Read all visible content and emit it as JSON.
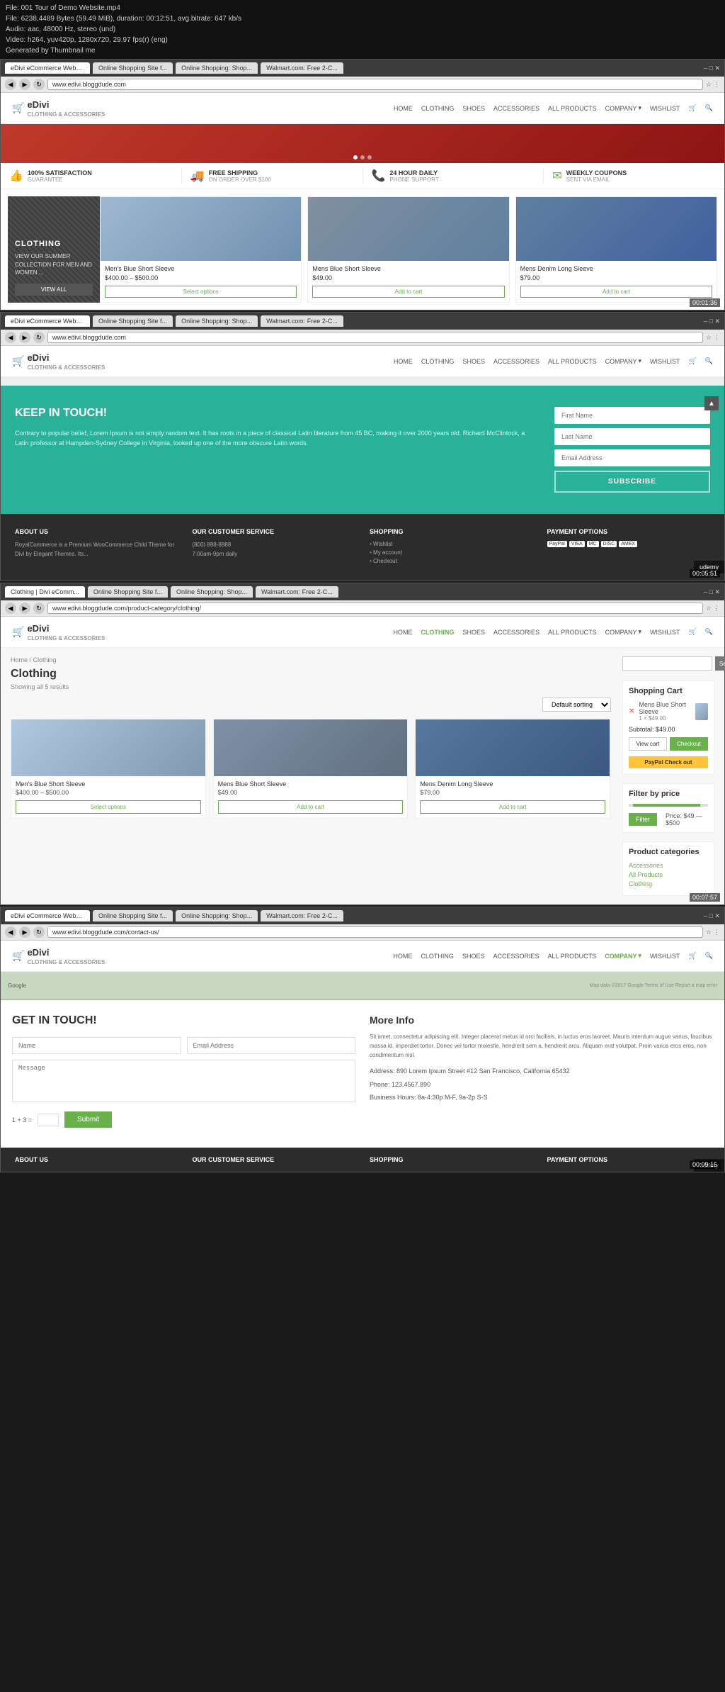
{
  "videoInfo": {
    "filename": "File: 001 Tour of Demo Website.mp4",
    "size": "File: 6238,4489 Bytes (59.49 MiB), duration: 00:12:51, avg.bitrate: 647 kb/s",
    "audio": "Audio: aac, 48000 Hz, stereo (und)",
    "video": "Video: h264, yuv420p, 1280x720, 29.97 fps(r) (eng)",
    "generated": "Generated by Thumbnail me"
  },
  "section1": {
    "tabs": [
      "eDivi eCommerce Webs...",
      "Online Shopping Site f...",
      "Online Shopping: Shop...",
      "Walmart.com: Free 2-C..."
    ],
    "activeTab": 0,
    "url": "www.edivi.bloggdude.com",
    "timestamp": "00:01:36",
    "nav": {
      "logo": "eDivi",
      "logoSub": "CLOTHING & ACCESSORIES",
      "links": [
        "HOME",
        "CLOTHING",
        "SHOES",
        "ACCESSORIES",
        "ALL PRODUCTS",
        "COMPANY",
        "WISHLIST"
      ]
    },
    "features": [
      {
        "icon": "👍",
        "title": "100% SATISFACTION",
        "sub": "GUARANTEE"
      },
      {
        "icon": "🚚",
        "title": "FREE SHIPPING",
        "sub": "ON ORDER OVER $100"
      },
      {
        "icon": "📞",
        "title": "24 HOUR DAILY",
        "sub": "PHONE SUPPORT"
      },
      {
        "icon": "✉",
        "title": "WEEKLY COUPONS",
        "sub": "SENT VIA EMAIL"
      }
    ],
    "clothingBanner": {
      "label": "CLOTHING",
      "sub": "VIEW OUR SUMMER COLLECTION FOR MEN AND WOMEN ...",
      "btnLabel": "VIEW ALL"
    },
    "products": [
      {
        "name": "Men's Blue Short Sleeve",
        "price": "$400.00 – $500.00",
        "btn": "Select options",
        "imgClass": "blue1"
      },
      {
        "name": "Mens Blue Short Sleeve",
        "price": "$49.00",
        "btn": "Add to cart",
        "imgClass": "blue2"
      },
      {
        "name": "Mens Denim Long Sleeve",
        "price": "$79.00",
        "btn": "Add to cart",
        "imgClass": "denim"
      }
    ],
    "sliderDots": 3
  },
  "section2": {
    "tabs": [
      "eDivi eCommerce Webs...",
      "Online Shopping Site f...",
      "Online Shopping: Shop...",
      "Walmart.com: Free 2-C..."
    ],
    "activeTab": 0,
    "url": "www.edivi.bloggdude.com",
    "timestamp": "00:05:51",
    "nav": {
      "logo": "eDivi",
      "logoSub": "CLOTHING & ACCESSORIES",
      "links": [
        "HOME",
        "CLOTHING",
        "SHOES",
        "ACCESSORIES",
        "ALL PRODUCTS",
        "COMPANY",
        "WISHLIST"
      ]
    },
    "keepInTouch": {
      "title": "KEEP IN TOUCH!",
      "text": "Contrary to popular belief, Lorem Ipsum is not simply random text. It has roots in a piece of classical Latin literature from 45 BC, making it over 2000 years old. Richard McClintock, a Latin professor at Hampden-Sydney College in Virginia, looked up one of the more obscure Latin words.",
      "firstNamePlaceholder": "First Name",
      "lastNamePlaceholder": "Last Name",
      "emailPlaceholder": "Email Address",
      "subscribeLabel": "SUBSCRIBE"
    },
    "footer": {
      "cols": [
        {
          "title": "ABOUT US",
          "text": "RoyalCommerce is a Premium WooCommerce Child Theme for Divi by Elegant Themes. Its..."
        },
        {
          "title": "OUR CUSTOMER SERVICE",
          "phone": "(800) 888-8888",
          "hours": "7:00am-9pm daily"
        },
        {
          "title": "SHOPPING",
          "items": [
            "Wishlist",
            "My account",
            "Checkout"
          ]
        },
        {
          "title": "PAYMENT OPTIONS",
          "icons": [
            "PayPal",
            "VISA",
            "MC",
            "DISC",
            "AMEX"
          ]
        }
      ]
    }
  },
  "section3": {
    "tabs": [
      "Clothing | Divi eComm...",
      "Online Shopping Site f...",
      "Online Shopping: Shop...",
      "Walmart.com: Free 2-C..."
    ],
    "activeTab": 0,
    "url": "www.edivi.bloggdude.com/product-category/clothing/",
    "timestamp": "00:07:57",
    "nav": {
      "logo": "eDivi",
      "logoSub": "CLOTHING & ACCESSORIES",
      "activeLink": "CLOTHING",
      "links": [
        "HOME",
        "CLOTHING",
        "SHOES",
        "ACCESSORIES",
        "ALL PRODUCTS",
        "COMPANY",
        "WISHLIST"
      ]
    },
    "breadcrumb": "Home / Clothing",
    "heading": "Clothing",
    "showing": "Showing all 5 results",
    "sortLabel": "Default sorting",
    "products": [
      {
        "name": "Men's Blue Short Sleeve",
        "price": "$400.00 – $500.00",
        "btn": "Select options",
        "imgClass": "shirt1"
      },
      {
        "name": "Mens Blue Short Sleeve",
        "price": "$49.00",
        "btn": "Add to cart",
        "imgClass": "shirt2"
      },
      {
        "name": "Mens Denim Long Sleeve",
        "price": "$79.00",
        "btn": "Add to cart",
        "imgClass": "shirt3"
      }
    ],
    "sidebar": {
      "searchPlaceholder": "",
      "searchBtn": "Search",
      "cartTitle": "Shopping Cart",
      "cartItem": {
        "name": "Mens Blue Short Sleeve",
        "qty": "1 × $49.00"
      },
      "subtotal": "Subtotal: $49.00",
      "viewCartLabel": "View cart",
      "checkoutLabel": "Checkout",
      "filterTitle": "Filter by price",
      "filterBtn": "Filter",
      "filterPrice": "Price: $49 — $500",
      "categoriesTitle": "Product categories",
      "categories": [
        "Accessories",
        "All Products",
        "Clothing"
      ]
    }
  },
  "section4": {
    "tabs": [
      "eDivi eCommerce Webs...",
      "Online Shopping Site f...",
      "Online Shopping: Shop...",
      "Walmart.com: Free 2-C..."
    ],
    "activeTab": 0,
    "url": "www.edivi.bloggdude.com/contact-us/",
    "timestamp": "00:09:15",
    "nav": {
      "logo": "eDivi",
      "logoSub": "CLOTHING & ACCESSORIES",
      "activeLink": "COMPANY",
      "links": [
        "HOME",
        "CLOTHING",
        "SHOES",
        "ACCESSORIES",
        "ALL PRODUCTS",
        "COMPANY",
        "WISHLIST"
      ]
    },
    "mapLabel": "Google",
    "contact": {
      "title": "GET IN TOUCH!",
      "namePlaceholder": "Name",
      "emailPlaceholder": "Email Address",
      "messagePlaceholder": "Message",
      "captchaLabel": "1 + 3 =",
      "captchaValue": "",
      "submitLabel": "Submit"
    },
    "moreInfo": {
      "title": "More Info",
      "text": "Sit amet, consectetur adipiscing elit. Integer placerat metus id orci facilisis, in luctus eros laoreet. Mauris interdum augue varius, faucibus massa id, imperdiet tortor. Donec vel tortor molestie, hendrerit sem a, hendrerit arcu. Aliquam erat volutpat. Proin varius eros eros, non condimentum nisl.",
      "address": "Address: 890 Lorem Ipsum Street #12\nSan Francisco, California 65432",
      "phone": "Phone: 123.4567.890",
      "hours": "Business Hours: 8a-4:30p M-F, 9a-2p S-S"
    },
    "footer": {
      "cols": [
        {
          "title": "ABOUT US"
        },
        {
          "title": "OUR CUSTOMER SERVICE"
        },
        {
          "title": "SHOPPING"
        },
        {
          "title": "PAYMENT OPTIONS"
        }
      ]
    }
  }
}
